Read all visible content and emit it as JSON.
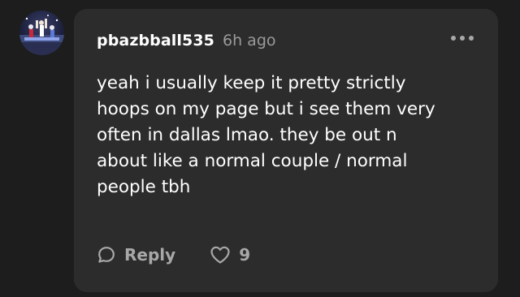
{
  "comment": {
    "username": "pbazbball535",
    "time": "6h ago",
    "text": "yeah i usually keep it pretty strictly\nhoops on my page but i see them very\noften in dallas lmao. they be out n\nabout like a normal couple / normal\npeople tbh",
    "reply_label": "Reply",
    "like_count": "9"
  },
  "icons": {
    "more": "more-options-icon",
    "reply": "speech-bubble-icon",
    "like": "heart-icon"
  },
  "colors": {
    "background": "#1d1d1d",
    "card": "#2c2c2c",
    "text": "#ffffff",
    "muted": "#9a9a9a"
  }
}
